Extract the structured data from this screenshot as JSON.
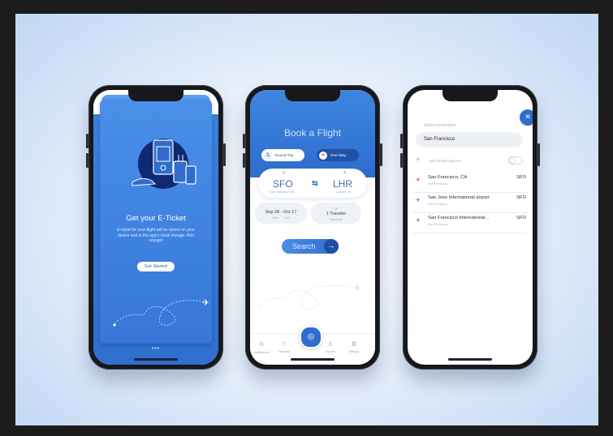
{
  "phone1": {
    "title": "Get your E-Ticket",
    "description": "E-ticket for your flight will be stored on your device and in the app's cloud storage. Bon voyage!",
    "cta": "Get Started",
    "pager": "•••"
  },
  "phone2": {
    "title": "Book a Flight",
    "trip_types": [
      {
        "label": "Round-Trip",
        "selected": false
      },
      {
        "label": "One-Way",
        "selected": true
      }
    ],
    "from": {
      "code": "SFO",
      "city": "San Francisco, USA"
    },
    "to": {
      "code": "LHR",
      "city": "London, UK"
    },
    "dates": {
      "value": "Sep 28  -  Oct 17",
      "from_sub": "Wed",
      "to_sub": "Tue"
    },
    "travelers": {
      "value": "1 Traveler",
      "sub": "Economy"
    },
    "search_label": "Search",
    "tabs": [
      {
        "label": "Notifications",
        "icon": "bell-icon"
      },
      {
        "label": "Watchlist",
        "icon": "bookmark-icon"
      },
      {
        "label": "",
        "icon": "globe-plane-icon"
      },
      {
        "label": "Booked",
        "icon": "user-icon"
      },
      {
        "label": "Settings",
        "icon": "gear-icon"
      }
    ]
  },
  "phone3": {
    "label": "Select destination",
    "input_value": "San Francisco",
    "nearby_label": "Add nearby airports",
    "nearby_enabled": false,
    "results": [
      {
        "name": "San Francisco, CA",
        "sub": "San Francisco",
        "code": "SFO",
        "plane_color": "#e23b3b"
      },
      {
        "name": "San Jose International airport",
        "sub": "San Francisco",
        "code": "SFO",
        "plane_color": "#2f6ccd"
      },
      {
        "name": "San Francisco International...",
        "sub": "San Francisco",
        "code": "SFO",
        "plane_color": "#2f6ccd"
      }
    ]
  },
  "colors": {
    "primary": "#2f6ccd",
    "accent_red": "#e23b3b",
    "dark_blue": "#1f52a8"
  }
}
